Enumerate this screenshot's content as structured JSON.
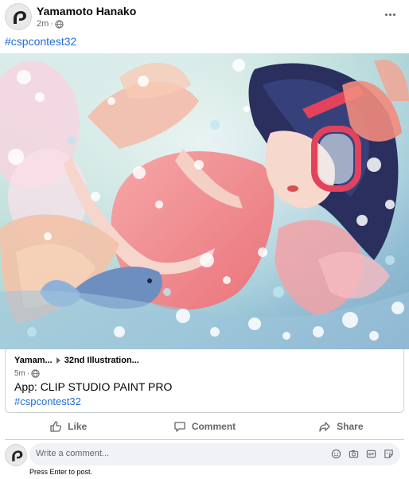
{
  "post": {
    "author": "Yamamoto Hanako",
    "time": "2m",
    "hashtag": "#cspcontest32"
  },
  "icons": {
    "avatar": "clip-studio-logo",
    "privacy": "globe-icon",
    "more": "more-options-icon"
  },
  "attachment": {
    "breadcrumb_user": "Yamam...",
    "breadcrumb_title": "32nd Illustration...",
    "time": "5m",
    "app_label": "App: CLIP STUDIO PAINT PRO",
    "hashtag": "#cspcontest32"
  },
  "actions": [
    {
      "label": "Like",
      "icon": "thumbs-up-icon"
    },
    {
      "label": "Comment",
      "icon": "comment-icon"
    },
    {
      "label": "Share",
      "icon": "share-icon"
    }
  ],
  "comment": {
    "placeholder": "Write a comment...",
    "hint": "Press Enter to post.",
    "icons": [
      "emoji-icon",
      "camera-icon",
      "gif-icon",
      "sticker-icon"
    ]
  },
  "colors": {
    "link": "#216fdb",
    "secondary_text": "#65676b",
    "comment_bg": "#f0f2f5"
  }
}
